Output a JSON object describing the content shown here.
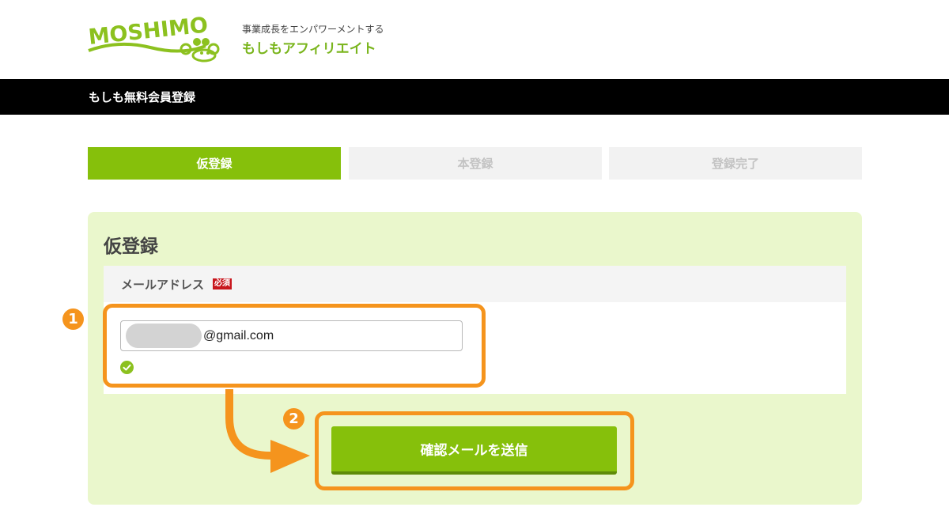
{
  "header": {
    "logo_text": "MOSHIMO",
    "tagline_small": "事業成長をエンパワーメントする",
    "tagline_main": "もしもアフィリエイト"
  },
  "title_bar": {
    "text": "もしも無料会員登録"
  },
  "steps": [
    {
      "label": "仮登録",
      "active": true
    },
    {
      "label": "本登録",
      "active": false
    },
    {
      "label": "登録完了",
      "active": false
    }
  ],
  "form": {
    "title": "仮登録",
    "email_label": "メールアドレス",
    "required_badge": "必須",
    "email_value": "@gmail.com",
    "submit_label": "確認メールを送信"
  },
  "annotations": {
    "step1": "1",
    "step2": "2",
    "color": "#f5941d"
  },
  "colors": {
    "brand_green": "#86c00b",
    "panel_bg": "#eaf7cc",
    "required_red": "#c8161d"
  }
}
